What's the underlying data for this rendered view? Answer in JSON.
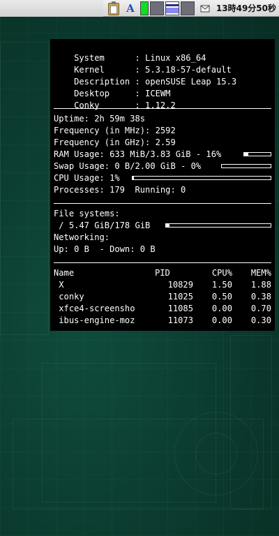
{
  "tray": {
    "input_method_label": "A",
    "clock": "13時49分50秒",
    "icons": [
      "clipboard-icon",
      "input-method-icon",
      "cpu-monitor",
      "memory-monitor",
      "network-monitor",
      "swap-monitor",
      "mail-icon"
    ],
    "colors": {
      "cpu_graph": "#11dd22",
      "net_graph": "#8888ee"
    }
  },
  "conky": {
    "info": [
      {
        "label": "System     ",
        "value": ": Linux x86_64"
      },
      {
        "label": "Kernel     ",
        "value": ": 5.3.18-57-default"
      },
      {
        "label": "Description",
        "value": ": openSUSE Leap 15.3"
      },
      {
        "label": "Desktop    ",
        "value": ": ICEWM"
      },
      {
        "label": "Conky      ",
        "value": ": 1.12.2"
      }
    ],
    "uptime": "Uptime: 2h 59m 38s",
    "freq_mhz": "Frequency (in MHz): 2592",
    "freq_ghz": "Frequency (in GHz): 2.59",
    "ram": "RAM Usage: 633 MiB/3.83 GiB - 16%",
    "swap": "Swap Usage: 0 B/2.00 GiB - 0%",
    "cpu": "CPU Usage: 1%",
    "processes": "Processes: 179  Running: 0",
    "usage": {
      "ram_fraction": 0.16,
      "swap_fraction": 0.0,
      "cpu_fraction": 0.01,
      "fs_fraction": 0.03
    },
    "fs_title": "File systems:",
    "fs_root": " / 5.47 GiB/178 GiB",
    "net_title": "Networking:",
    "net_line": "Up: 0 B  - Down: 0 B",
    "proc_headers": {
      "name": "Name",
      "pid": "PID",
      "cpu": "CPU%",
      "mem": "MEM%"
    },
    "processes_list": [
      {
        "name": " X",
        "pid": "10829",
        "cpu": "1.50",
        "mem": "1.88"
      },
      {
        "name": " conky",
        "pid": "11025",
        "cpu": "0.50",
        "mem": "0.38"
      },
      {
        "name": " xfce4-screensho",
        "pid": "11085",
        "cpu": "0.00",
        "mem": "0.70"
      },
      {
        "name": " ibus-engine-moz",
        "pid": "11073",
        "cpu": "0.00",
        "mem": "0.30"
      }
    ]
  }
}
